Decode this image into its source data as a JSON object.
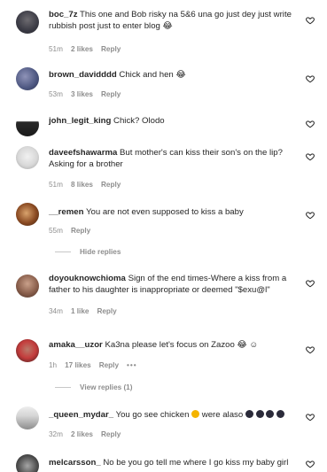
{
  "comments": [
    {
      "user": "boc_7z",
      "text": "This one and Bob risky na 5&6 una go just dey just write rubbish post just to enter blog",
      "emoji": "😂",
      "time": "51m",
      "likes": "2 likes",
      "reply": "Reply"
    },
    {
      "user": "brown_davidddd",
      "text": "Chick and hen",
      "emoji": "😂",
      "time": "53m",
      "likes": "3 likes",
      "reply": "Reply"
    },
    {
      "user": "john_legit_king",
      "text": "Chick? Olodo"
    },
    {
      "user": "daveefshawarma",
      "text": "But mother's can kiss their son's on the lip? Asking for a brother",
      "time": "51m",
      "likes": "8 likes",
      "reply": "Reply"
    },
    {
      "user": "__remen",
      "text": "You are not even supposed to kiss a baby",
      "time": "55m",
      "reply": "Reply",
      "hide_replies": "Hide replies"
    },
    {
      "user": "doyouknowchioma",
      "text": "Sign of the end times-Where a kiss from a father to his daughter is inappropriate or deemed \"$exu@l\"",
      "time": "34m",
      "likes": "1 like",
      "reply": "Reply"
    },
    {
      "user": "amaka__uzor",
      "text": "Ka3na please let's focus on Zazoo",
      "emoji": "😂 ☺",
      "time": "1h",
      "likes": "17 likes",
      "reply": "Reply",
      "more": "•••",
      "view_replies": "View replies (1)"
    },
    {
      "user": "_queen_mydar_",
      "text": "You go see chicken",
      "text2": "were alaso",
      "time": "32m",
      "likes": "2 likes",
      "reply": "Reply"
    },
    {
      "user": "melcarsson_",
      "text": "No be you go tell me where I go kiss my baby girl"
    }
  ]
}
